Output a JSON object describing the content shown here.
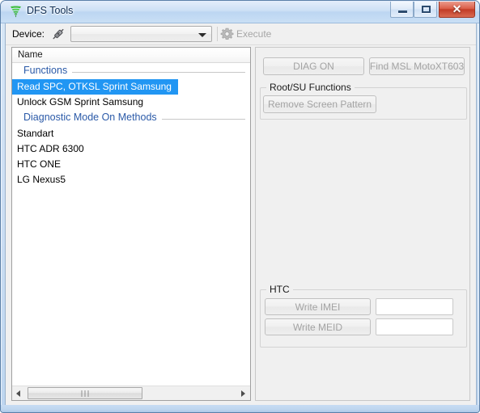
{
  "window": {
    "title": "DFS Tools",
    "icon": "funnel-icon",
    "controls": {
      "minimize": "–",
      "maximize": "□",
      "close": "✕"
    }
  },
  "toolbar": {
    "device_label": "Device:",
    "plug_icon": "plug-icon",
    "device_combo_value": "",
    "device_combo_placeholder": "",
    "gear_icon": "gear-icon",
    "execute_label": "Execute"
  },
  "list_panel": {
    "header": "Name",
    "rows": [
      {
        "type": "group",
        "label": "Functions"
      },
      {
        "type": "item",
        "label": "Read SPC, OTKSL Sprint Samsung",
        "selected": true
      },
      {
        "type": "item",
        "label": "Unlock GSM Sprint Samsung",
        "selected": false
      },
      {
        "type": "group",
        "label": "Diagnostic Mode On Methods"
      },
      {
        "type": "item",
        "label": "Standart",
        "selected": false
      },
      {
        "type": "item",
        "label": "HTC ADR 6300",
        "selected": false
      },
      {
        "type": "item",
        "label": "HTC ONE",
        "selected": false
      },
      {
        "type": "item",
        "label": "LG Nexus5",
        "selected": false
      }
    ],
    "scrollbar": {
      "left_arrow": "scroll-left-arrow-icon",
      "right_arrow": "scroll-right-arrow-icon"
    }
  },
  "right_panel": {
    "diag_on_label": "DIAG ON",
    "find_msl_label": "Find MSL MotoXT603",
    "root_su_group_title": "Root/SU Functions",
    "remove_screen_pattern_label": "Remove Screen Pattern",
    "htc_group_title": "HTC",
    "write_imei_label": "Write IMEI",
    "write_meid_label": "Write MEID",
    "imei_value": "",
    "meid_value": ""
  },
  "colors": {
    "selection_blue": "#2196f3",
    "group_header_blue": "#2b5aa8",
    "titlebar_blue": "#cfe0f4",
    "close_button_red": "#c23c26",
    "disabled_text": "#a3a3a3",
    "panel_grey": "#f0f0f0"
  }
}
